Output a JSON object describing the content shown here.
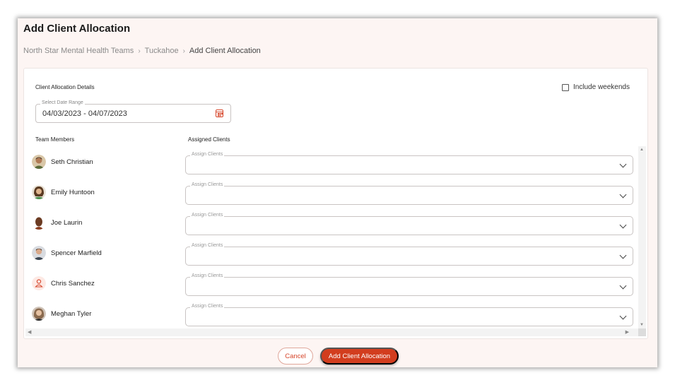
{
  "page": {
    "title": "Add Client Allocation",
    "breadcrumb": [
      "North Star Mental Health Teams",
      "Tuckahoe",
      "Add Client Allocation"
    ]
  },
  "card": {
    "section_label": "Client Allocation Details",
    "include_weekends_label": "Include weekends",
    "include_weekends_checked": false,
    "date_range_legend": "Select Date Range",
    "date_range_value": "04/03/2023 - 04/07/2023",
    "col_team_members": "Team Members",
    "col_assigned_clients": "Assigned Clients"
  },
  "members": [
    {
      "name": "Seth Christian",
      "assign_legend": "Assign Clients",
      "avatar": "photo"
    },
    {
      "name": "Emily Huntoon",
      "assign_legend": "Assign Clients",
      "avatar": "photo"
    },
    {
      "name": "Joe Laurin",
      "assign_legend": "Assign Clients",
      "avatar": "photo"
    },
    {
      "name": "Spencer Marfield",
      "assign_legend": "Assign Clients",
      "avatar": "photo"
    },
    {
      "name": "Chris Sanchez",
      "assign_legend": "Assign Clients",
      "avatar": "person-icon"
    },
    {
      "name": "Meghan Tyler",
      "assign_legend": "Assign Clients",
      "avatar": "photo"
    }
  ],
  "footer": {
    "cancel_label": "Cancel",
    "submit_label": "Add Client Allocation"
  },
  "colors": {
    "accent": "#d23d1e",
    "background": "#fdf5f3"
  }
}
